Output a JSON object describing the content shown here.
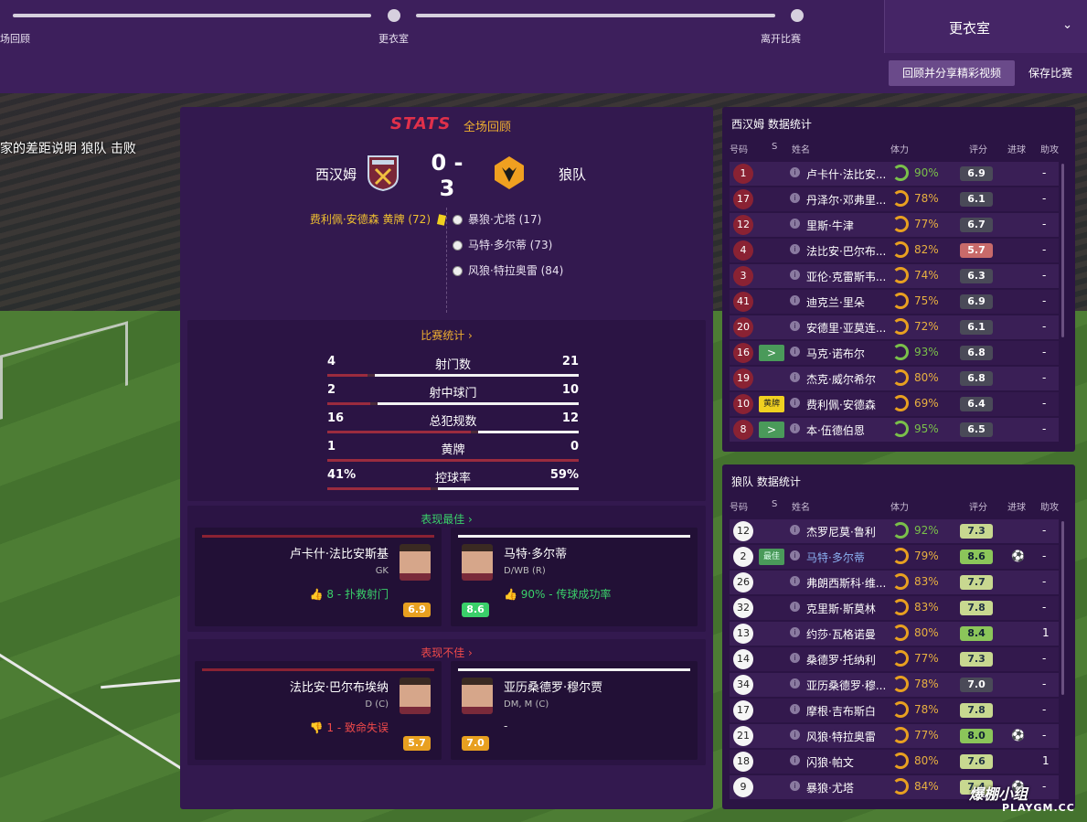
{
  "progress": {
    "steps": [
      "场回顾",
      "更衣室",
      "离开比赛"
    ]
  },
  "room_select": {
    "label": "更衣室"
  },
  "buttons": {
    "review": "回顾并分享精彩视频",
    "save": "保存比赛"
  },
  "overlay_text": "家的差距说明 狼队 击败",
  "main": {
    "logo": "STATS",
    "subtitle": "全场回顾",
    "home": "西汉姆",
    "away": "狼队",
    "score": "0 - 3",
    "home_event": "费利佩·安德森 黄牌 (72)",
    "away_events": [
      "暴狼·尤塔 (17)",
      "马特·多尔蒂 (73)",
      "风狼·特拉奥雷 (84)"
    ],
    "match_stats_title": "比赛统计 ›",
    "stats": [
      {
        "label": "射门数",
        "home": "4",
        "away": "21",
        "home_frac": 0.16
      },
      {
        "label": "射中球门",
        "home": "2",
        "away": "10",
        "home_frac": 0.17
      },
      {
        "label": "总犯规数",
        "home": "16",
        "away": "12",
        "home_frac": 0.57
      },
      {
        "label": "黄牌",
        "home": "1",
        "away": "0",
        "home_frac": 1.0
      },
      {
        "label": "控球率",
        "home": "41%",
        "away": "59%",
        "home_frac": 0.41
      }
    ],
    "best_title": "表现最佳 ›",
    "worst_title": "表现不佳 ›",
    "best": [
      {
        "name": "卢卡什·法比安斯基",
        "pos": "GK",
        "note": "8 - 扑救射门",
        "rating": "6.9"
      },
      {
        "name": "马特·多尔蒂",
        "pos": "D/WB (R)",
        "note": "90% - 传球成功率",
        "rating": "8.6"
      }
    ],
    "worst": [
      {
        "name": "法比安·巴尔布埃纳",
        "pos": "D (C)",
        "note": "1 - 致命失误",
        "rating": "5.7"
      },
      {
        "name": "亚历桑德罗·穆尔贾",
        "pos": "DM, M (C)",
        "note": "-",
        "rating": "7.0"
      }
    ]
  },
  "headers": {
    "num": "号码",
    "s": "S",
    "name": "姓名",
    "cond": "体力",
    "rating": "评分",
    "goals": "进球",
    "assists": "助攻"
  },
  "home_table": {
    "title": "西汉姆 数据统计",
    "rows": [
      {
        "num": "1",
        "s": "",
        "name": "卢卡什·法比安...",
        "cond": "90%",
        "rating": "6.9",
        "g": "",
        "a": "-"
      },
      {
        "num": "17",
        "s": "",
        "name": "丹泽尔·邓弗里...",
        "cond": "78%",
        "rating": "6.1",
        "g": "",
        "a": "-"
      },
      {
        "num": "12",
        "s": "",
        "name": "里斯·牛津",
        "cond": "77%",
        "rating": "6.7",
        "g": "",
        "a": "-"
      },
      {
        "num": "4",
        "s": "",
        "name": "法比安·巴尔布...",
        "cond": "82%",
        "rating": "5.7",
        "g": "",
        "a": "-"
      },
      {
        "num": "3",
        "s": "",
        "name": "亚伦·克雷斯韦...",
        "cond": "74%",
        "rating": "6.3",
        "g": "",
        "a": "-"
      },
      {
        "num": "41",
        "s": "",
        "name": "迪克兰·里朵",
        "cond": "75%",
        "rating": "6.9",
        "g": "",
        "a": "-"
      },
      {
        "num": "20",
        "s": "",
        "name": "安德里·亚莫连...",
        "cond": "72%",
        "rating": "6.1",
        "g": "",
        "a": "-"
      },
      {
        "num": "16",
        "s": ">",
        "name": "马克·诺布尔",
        "cond": "93%",
        "rating": "6.8",
        "g": "",
        "a": "-"
      },
      {
        "num": "19",
        "s": "",
        "name": "杰克·威尔希尔",
        "cond": "80%",
        "rating": "6.8",
        "g": "",
        "a": "-"
      },
      {
        "num": "10",
        "s": "黄牌",
        "name": "费利佩·安德森",
        "cond": "69%",
        "rating": "6.4",
        "g": "",
        "a": "-"
      },
      {
        "num": "8",
        "s": ">",
        "name": "本·伍德伯恩",
        "cond": "95%",
        "rating": "6.5",
        "g": "",
        "a": "-"
      }
    ]
  },
  "away_table": {
    "title": "狼队 数据统计",
    "rows": [
      {
        "num": "12",
        "s": "",
        "name": "杰罗尼莫·鲁利",
        "cond": "92%",
        "rating": "7.3",
        "g": "",
        "a": "-"
      },
      {
        "num": "2",
        "s": "最佳",
        "name": "马特·多尔蒂",
        "cond": "79%",
        "rating": "8.6",
        "g": "⚽",
        "a": "-"
      },
      {
        "num": "26",
        "s": "",
        "name": "弗朗西斯科·维...",
        "cond": "83%",
        "rating": "7.7",
        "g": "",
        "a": "-"
      },
      {
        "num": "32",
        "s": "",
        "name": "克里斯·斯莫林",
        "cond": "83%",
        "rating": "7.8",
        "g": "",
        "a": "-"
      },
      {
        "num": "13",
        "s": "",
        "name": "约莎·瓦格诺曼",
        "cond": "80%",
        "rating": "8.4",
        "g": "",
        "a": "1"
      },
      {
        "num": "14",
        "s": "",
        "name": "桑德罗·托纳利",
        "cond": "77%",
        "rating": "7.3",
        "g": "",
        "a": "-"
      },
      {
        "num": "34",
        "s": "",
        "name": "亚历桑德罗·穆...",
        "cond": "78%",
        "rating": "7.0",
        "g": "",
        "a": "-"
      },
      {
        "num": "17",
        "s": "",
        "name": "摩根·吉布斯白",
        "cond": "78%",
        "rating": "7.8",
        "g": "",
        "a": "-"
      },
      {
        "num": "21",
        "s": "",
        "name": "风狼·特拉奥雷",
        "cond": "77%",
        "rating": "8.0",
        "g": "⚽",
        "a": "-"
      },
      {
        "num": "18",
        "s": "",
        "name": "闪狼·帕文",
        "cond": "80%",
        "rating": "7.6",
        "g": "",
        "a": "1"
      },
      {
        "num": "9",
        "s": "",
        "name": "暴狼·尤塔",
        "cond": "84%",
        "rating": "7.4",
        "g": "⚽",
        "a": "-"
      }
    ]
  },
  "watermark": {
    "line1": "爆棚小组",
    "line2": "PLAYGM.CC"
  }
}
